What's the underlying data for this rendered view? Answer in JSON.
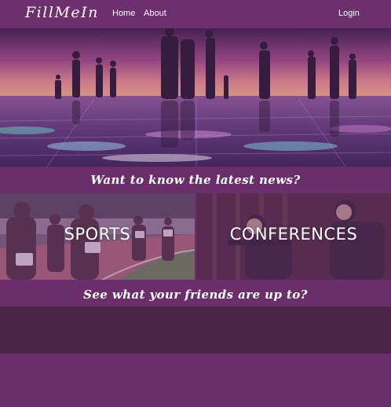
{
  "brand": "FillMeIn",
  "nav": {
    "home": "Home",
    "about": "About",
    "login": "Login"
  },
  "headings": {
    "news": "Want to know the latest news?",
    "friends": "See what your friends are up to?"
  },
  "tiles": [
    {
      "label": "SPORTS"
    },
    {
      "label": "CONFERENCES"
    }
  ],
  "colors": {
    "primary": "#6d2f6e",
    "dark_band": "#4a2349",
    "text": "#ffffff"
  }
}
